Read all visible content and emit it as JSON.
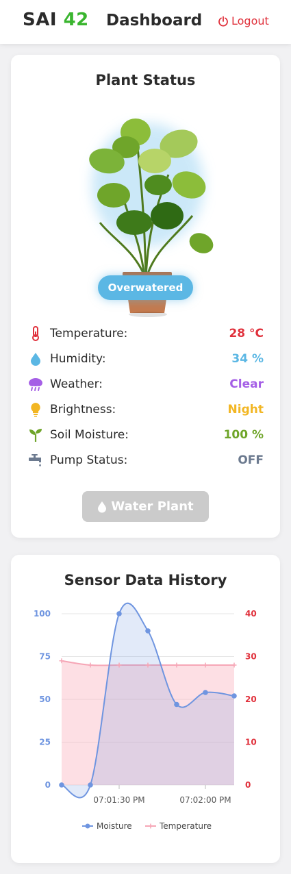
{
  "header": {
    "brand_text": "SAI",
    "brand_number": "42",
    "title": "Dashboard",
    "logout_label": "Logout"
  },
  "status_card": {
    "title": "Plant Status",
    "status_badge": "Overwatered",
    "rows": [
      {
        "icon": "thermometer-icon",
        "label": "Temperature:",
        "value": "28 °C",
        "color": "#e0303b"
      },
      {
        "icon": "water-drop-icon",
        "label": "Humidity:",
        "value": "34 %",
        "color": "#5bb7e4"
      },
      {
        "icon": "rain-cloud-icon",
        "label": "Weather:",
        "value": "Clear",
        "color": "#a55fe6"
      },
      {
        "icon": "lightbulb-icon",
        "label": "Brightness:",
        "value": "Night",
        "color": "#f2b623"
      },
      {
        "icon": "seedling-icon",
        "label": "Soil Moisture:",
        "value": "100 %",
        "color": "#6fa52a"
      },
      {
        "icon": "faucet-icon",
        "label": "Pump Status:",
        "value": "OFF",
        "color": "#6c7a8f"
      }
    ],
    "water_button_label": "Water Plant"
  },
  "history_card": {
    "title": "Sensor Data History"
  },
  "colors": {
    "moisture": "#6f95e0",
    "temperature": "#f6a6b6",
    "accent_red": "#e0303b",
    "accent_green": "#3ab52f"
  },
  "chart_data": {
    "type": "line",
    "x_tick_labels": [
      "07:01:30 PM",
      "07:02:00 PM"
    ],
    "x_tick_positions": [
      2,
      5
    ],
    "y_left": {
      "ticks": [
        0,
        25,
        50,
        75,
        100
      ],
      "range": [
        0,
        100
      ]
    },
    "y_right": {
      "ticks": [
        0,
        10,
        20,
        30,
        40
      ],
      "range": [
        0,
        40
      ]
    },
    "series": [
      {
        "name": "Moisture",
        "axis": "left",
        "values": [
          0,
          0,
          100,
          90,
          47,
          54,
          52
        ]
      },
      {
        "name": "Temperature",
        "axis": "right",
        "values": [
          29,
          28,
          28,
          28,
          28,
          28,
          28
        ]
      }
    ],
    "legend": "bottom"
  }
}
